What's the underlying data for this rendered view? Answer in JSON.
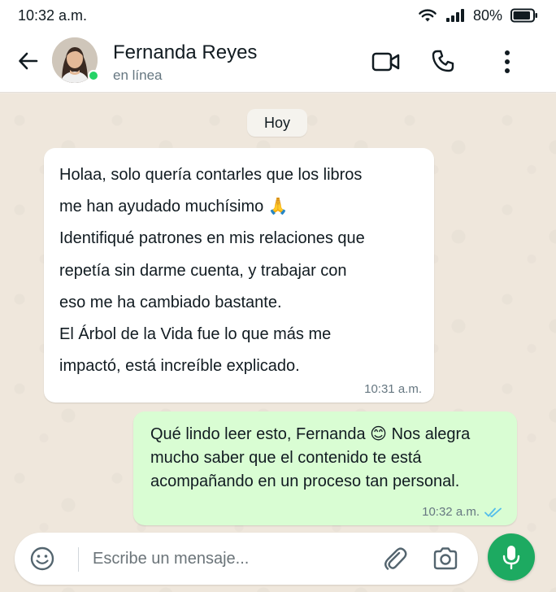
{
  "status_bar": {
    "time": "10:32 a.m.",
    "battery": "80%"
  },
  "header": {
    "contact_name": "Fernanda Reyes",
    "contact_status": "en línea"
  },
  "chat": {
    "date_label": "Hoy",
    "messages": [
      {
        "direction": "incoming",
        "lines": [
          "Holaa, solo quería contarles que los libros",
          "me han ayudado muchísimo 🙏",
          "Identifiqué patrones en mis relaciones que",
          "repetía sin darme cuenta, y trabajar con",
          "eso me ha cambiado bastante.",
          "El Árbol de la Vida fue lo que más me",
          "impactó, está increíble explicado."
        ],
        "time": "10:31 a.m."
      },
      {
        "direction": "outgoing",
        "lines": [
          "Qué lindo leer esto, Fernanda 😊 Nos alegra",
          "mucho saber que el contenido te está",
          "acompañando en un proceso tan personal."
        ],
        "time": "10:32 a.m.",
        "read": true
      }
    ]
  },
  "composer": {
    "placeholder": "Escribe un mensaje..."
  },
  "icons": {
    "back": "arrow-left-icon",
    "video": "video-camera-icon",
    "call": "phone-icon",
    "menu": "more-vertical-icon",
    "emoji": "emoji-icon",
    "attach": "paperclip-icon",
    "camera": "camera-icon",
    "mic": "microphone-icon",
    "read": "double-check-icon"
  },
  "colors": {
    "online": "#25d366",
    "outgoing_bubble": "#d9fdd3",
    "incoming_bubble": "#ffffff",
    "mic_button": "#1daa61",
    "read_check": "#53bdeb"
  }
}
